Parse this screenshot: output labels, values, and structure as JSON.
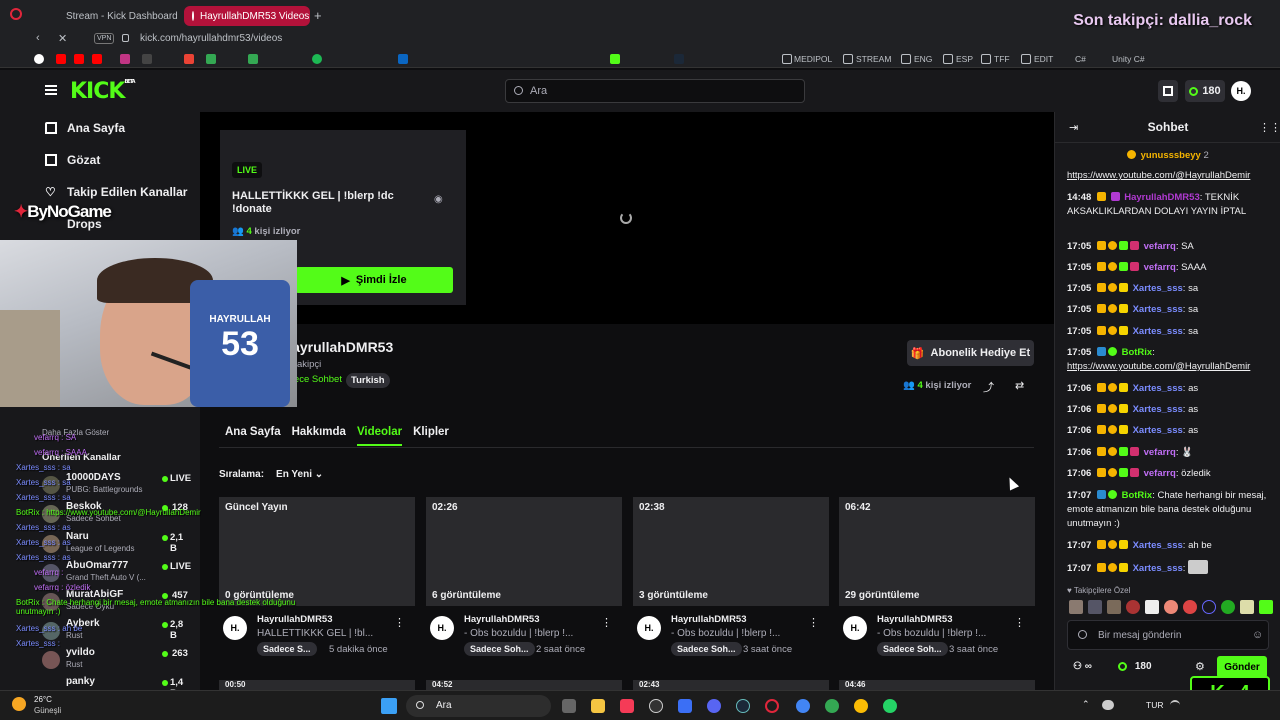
{
  "browser": {
    "tabs": [
      {
        "label": "Stream - Kick Dashboard"
      },
      {
        "label": "HayrullahDMR53 Videos - K"
      }
    ],
    "vpn": "VPN",
    "url": "kick.com/hayrullahdmr53/videos",
    "bookmarks": [
      "MEDIPOL",
      "STREAM",
      "ENG",
      "ESP",
      "TFF",
      "EDIT",
      "C#",
      "Unity C#"
    ]
  },
  "overlay": {
    "last_follower": "Son takipçi: dallia_rock",
    "brand": "ByNoGame",
    "shirt_name": "HAYRULLAH",
    "shirt_number": "53"
  },
  "header": {
    "logo": "KICK",
    "logo_beta": "BETA",
    "search_placeholder": "Ara",
    "points": "180",
    "avatar": "H."
  },
  "sidebar": {
    "items": [
      {
        "label": "Ana Sayfa",
        "icon": "home-icon"
      },
      {
        "label": "Gözat",
        "icon": "browse-icon"
      },
      {
        "label": "Takip Edilen Kanallar",
        "icon": "heart-icon"
      },
      {
        "label": "Drops",
        "icon": "drops-icon"
      }
    ],
    "show_more": "Daha Fazla Göster",
    "recommended_title": "Önerilen Kanallar",
    "recommended": [
      {
        "name": "10000DAYS",
        "game": "PUBG: Battlegrounds",
        "viewers": "LIVE"
      },
      {
        "name": "Beskok",
        "game": "Sadece Sohbet",
        "viewers": "128"
      },
      {
        "name": "Naru",
        "game": "League of Legends",
        "viewers": "2,1 B"
      },
      {
        "name": "AbuOmar777",
        "game": "Grand Theft Auto V (...",
        "viewers": "LIVE"
      },
      {
        "name": "MuratAbiGF",
        "game": "Sadece Oyku",
        "viewers": "457"
      },
      {
        "name": "Ayberk",
        "game": "Rust",
        "viewers": "2,8 B"
      },
      {
        "name": "yvildo",
        "game": "Rust",
        "viewers": "263"
      },
      {
        "name": "panky",
        "game": "",
        "viewers": "1,4 B"
      }
    ]
  },
  "player": {
    "live_badge": "LIVE",
    "title": "HALLETTİKKK GEL | !blerp !dc !donate",
    "viewers": "4",
    "viewers_label": "kişi izliyor",
    "watch_button": "Şimdi İzle"
  },
  "channel": {
    "name": "HayrullahDMR53",
    "followers": "akipçi",
    "category": "Sadece Sohbet",
    "language": "Turkish",
    "gift_button": "Abonelik Hediye Et",
    "viewers": "4",
    "viewers_label": "kişi izliyor"
  },
  "tabs": [
    "Ana Sayfa",
    "Hakkımda",
    "Videolar",
    "Klipler"
  ],
  "sort": {
    "label": "Sıralama:",
    "value": "En Yeni"
  },
  "videos": [
    {
      "duration": "Güncel Yayın",
      "views": "0 görüntüleme",
      "channel": "HayrullahDMR53",
      "title": "HALLETTİKKK GEL | !bl...",
      "tag": "Sadece S...",
      "when": "5 dakika önce"
    },
    {
      "duration": "02:26",
      "views": "6 görüntüleme",
      "channel": "HayrullahDMR53",
      "title": "- Obs bozuldu | !blerp !...",
      "tag": "Sadece Soh...",
      "when": "2 saat önce"
    },
    {
      "duration": "02:38",
      "views": "3 görüntüleme",
      "channel": "HayrullahDMR53",
      "title": "- Obs bozuldu | !blerp !...",
      "tag": "Sadece Soh...",
      "when": "3 saat önce"
    },
    {
      "duration": "06:42",
      "views": "29 görüntüleme",
      "channel": "HayrullahDMR53",
      "title": "- Obs bozuldu | !blerp !...",
      "tag": "Sadece Soh...",
      "when": "3 saat önce"
    }
  ],
  "next_row_durations": [
    "00:50",
    "04:52",
    "02:43",
    "04:46"
  ],
  "chat": {
    "title": "Sohbet",
    "top_user": "yunusssbeyy",
    "top_user_count": "2",
    "messages": [
      {
        "time": "",
        "user": "",
        "text": "https://www.youtube.com/@HayrullahDemir"
      },
      {
        "time": "14:48",
        "user": "HayrullahDMR53",
        "text": "TEKNİK AKSAKLIKLARDAN DOLAYI YAYIN İPTAL"
      },
      {
        "time": "17:05",
        "user": "vefarrq",
        "text": "SA"
      },
      {
        "time": "17:05",
        "user": "vefarrq",
        "text": "SAAA"
      },
      {
        "time": "17:05",
        "user": "Xartes_sss",
        "text": "sa"
      },
      {
        "time": "17:05",
        "user": "Xartes_sss",
        "text": "sa"
      },
      {
        "time": "17:05",
        "user": "Xartes_sss",
        "text": "sa"
      },
      {
        "time": "17:05",
        "user": "BotRix",
        "text": "https://www.youtube.com/@HayrullahDemir"
      },
      {
        "time": "17:06",
        "user": "Xartes_sss",
        "text": "as"
      },
      {
        "time": "17:06",
        "user": "Xartes_sss",
        "text": "as"
      },
      {
        "time": "17:06",
        "user": "Xartes_sss",
        "text": "as"
      },
      {
        "time": "17:06",
        "user": "vefarrq",
        "text": ""
      },
      {
        "time": "17:06",
        "user": "vefarrq",
        "text": "özledik"
      },
      {
        "time": "17:07",
        "user": "BotRix",
        "text": "Chate herhangi bir mesaj, emote atmanızın bile bana destek olduğunu unutmayın :)"
      },
      {
        "time": "17:07",
        "user": "Xartes_sss",
        "text": "ah be"
      },
      {
        "time": "17:07",
        "user": "Xartes_sss",
        "text": ""
      }
    ],
    "emote_title": "Takipçilere Özel",
    "input_placeholder": "Bir mesaj gönderin",
    "points": "180",
    "send_button": "Gönder"
  },
  "overlay_chat": [
    "vefarrq : SA",
    "vefarrq : SAAA",
    "Xartes_sss : sa",
    "Xartes_sss : sa",
    "Xartes_sss : sa",
    "BotRix : https://www.youtube.com/@HayrullahDemir",
    "Xartes_sss : as",
    "Xartes_sss : as",
    "Xartes_sss : as",
    "vefarrq :",
    "vefarrq : özledik",
    "BotRix : Chate herhangi bir mesaj, emote atmanızın bile bana destek olduğunu unutmayın :)",
    "Xartes_sss : ah be",
    "Xartes_sss :"
  ],
  "taskbar": {
    "weather_temp": "26°C",
    "weather_desc": "Güneşli",
    "search": "Ara",
    "lang": "TUR",
    "kick_counter": "4"
  },
  "colors": {
    "kick_green": "#53fc18",
    "background": "#0e0e10",
    "panel": "#18181b",
    "tab_active": "#b3123a"
  }
}
